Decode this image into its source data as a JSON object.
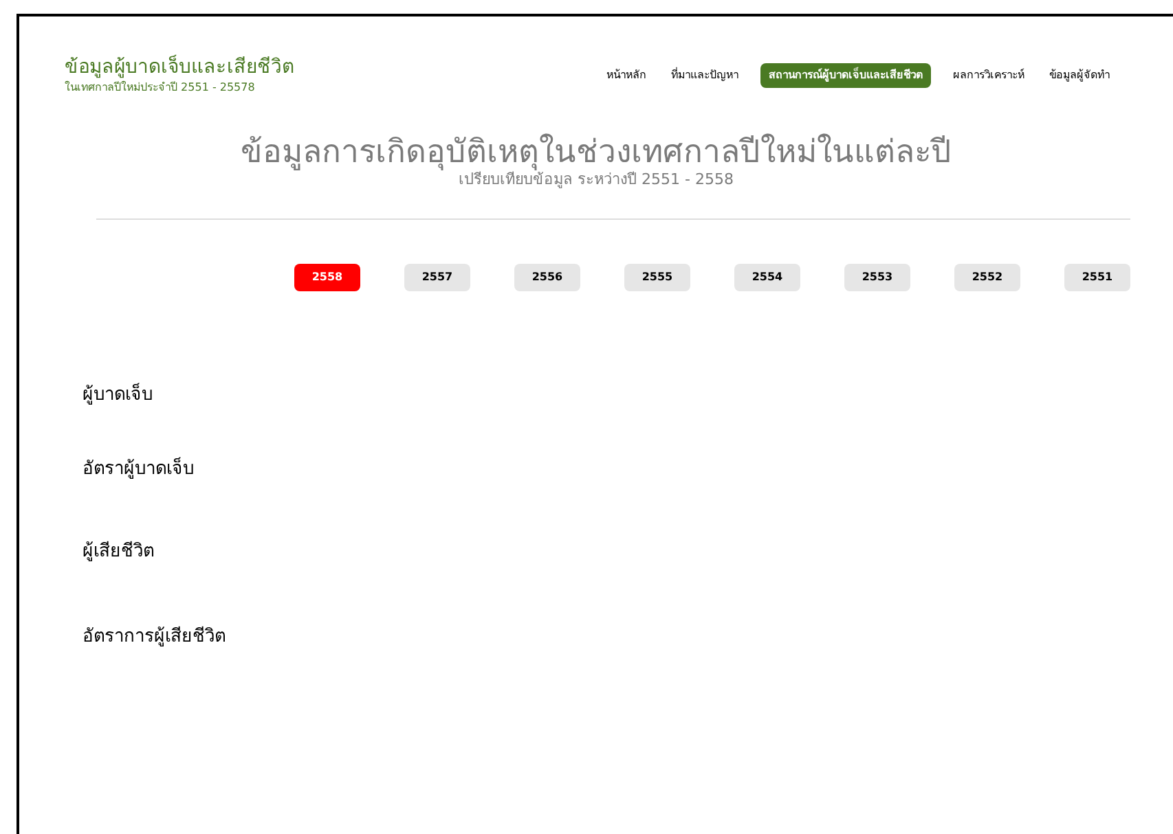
{
  "site": {
    "title": "ข้อมูลผู้บาดเจ็บและเสียชีวิต",
    "subtitle": "ในเทศกาลปีใหม่ประจำปี 2551 - 25578"
  },
  "nav": [
    {
      "label": "หน้าหลัก",
      "selected": false
    },
    {
      "label": "ที่มาและปัญหา",
      "selected": false
    },
    {
      "label": "สถานการณ์ผู้บาดเจ็บและเสียชีวต",
      "selected": true
    },
    {
      "label": "ผลการวิเคราะห์",
      "selected": false
    },
    {
      "label": "ข้อมูลผู้จัดทำ",
      "selected": false
    }
  ],
  "heading": {
    "title": "ข้อมูลการเกิดอุบัติเหตุในช่วงเทศกาลปีใหม่ในแต่ละปี",
    "subtitle": "เปรียบเทียบข้อมูล ระหว่างปี 2551 - 2558"
  },
  "years": [
    {
      "label": "2558",
      "selected": true
    },
    {
      "label": "2557",
      "selected": false
    },
    {
      "label": "2556",
      "selected": false
    },
    {
      "label": "2555",
      "selected": false
    },
    {
      "label": "2554",
      "selected": false
    },
    {
      "label": "2553",
      "selected": false
    },
    {
      "label": "2552",
      "selected": false
    },
    {
      "label": "2551",
      "selected": false
    }
  ],
  "sections": [
    "ผู้บาดเจ็บ",
    "อัตราผู้บาดเจ็บ",
    "ผู้เสียชีวิต",
    "อัตราการผู้เสียชีวิต"
  ]
}
